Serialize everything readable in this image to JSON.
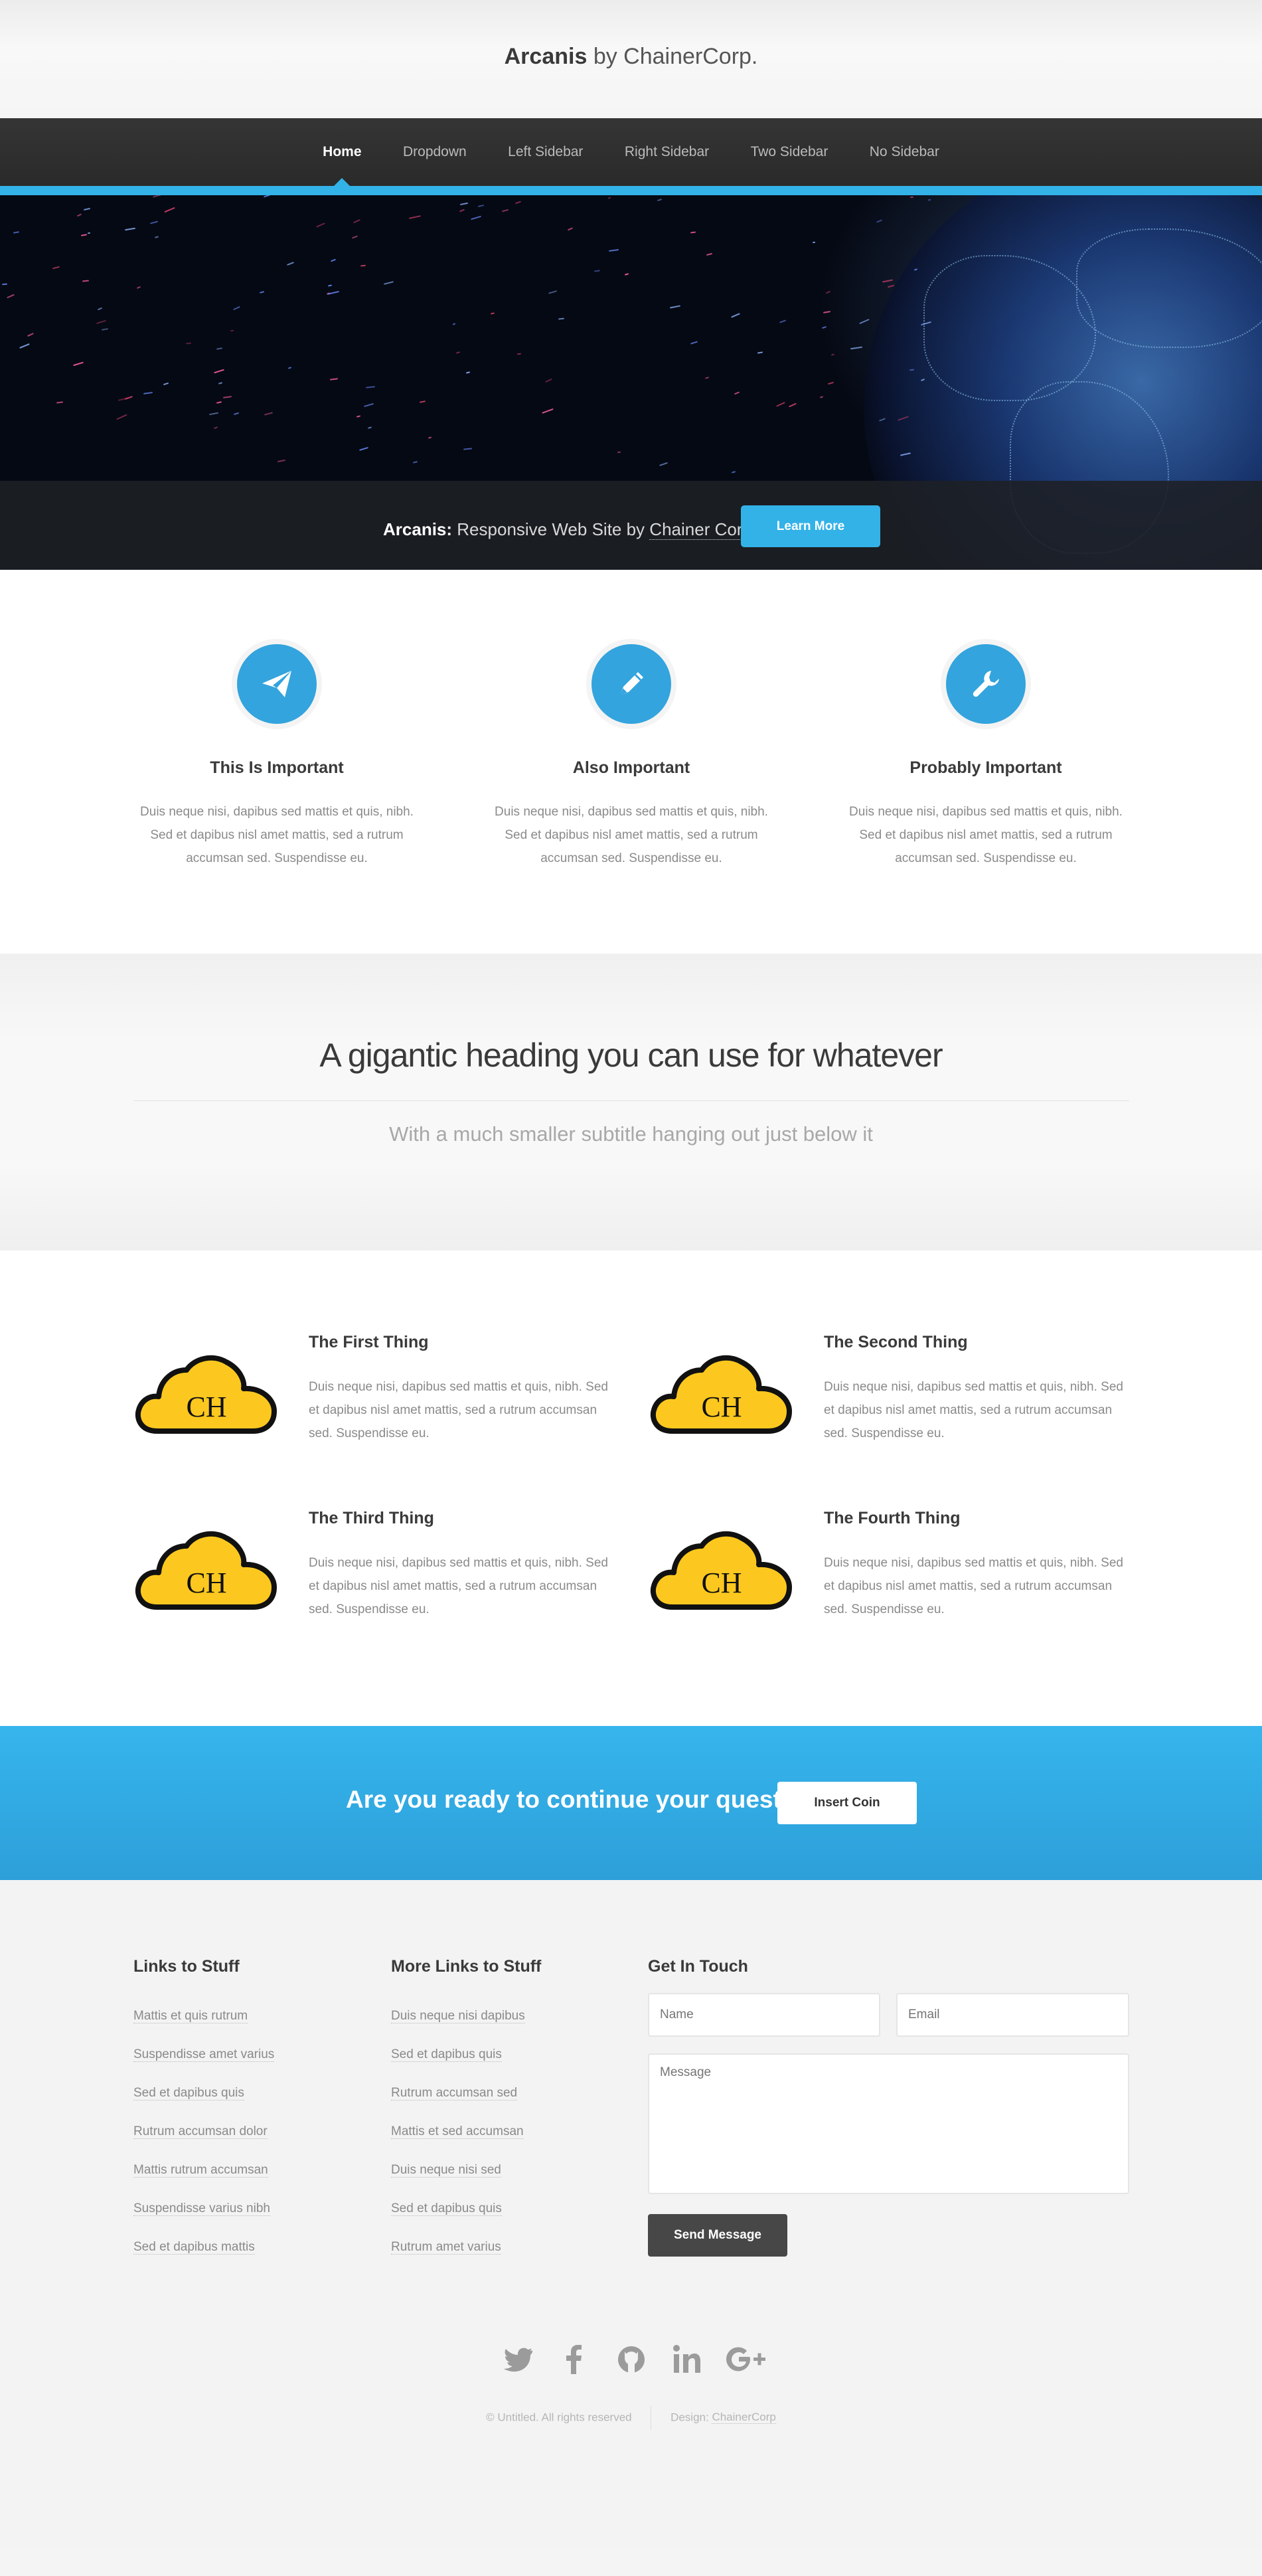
{
  "header": {
    "brand": "Arcanis",
    "brand_suffix": "by ChainerCorp."
  },
  "nav": {
    "items": [
      {
        "label": "Home"
      },
      {
        "label": "Dropdown"
      },
      {
        "label": "Left Sidebar"
      },
      {
        "label": "Right Sidebar"
      },
      {
        "label": "Two Sidebar"
      },
      {
        "label": "No Sidebar"
      }
    ]
  },
  "banner": {
    "tagline_bold": "Arcanis:",
    "tagline_text": "Responsive Web Site by",
    "tagline_link": "Chainer Corp",
    "button": "Learn More"
  },
  "features": [
    {
      "icon": "paper-plane-icon",
      "title": "This Is Important",
      "text": "Duis neque nisi, dapibus sed mattis et quis, nibh. Sed et dapibus nisl amet mattis, sed a rutrum accumsan sed. Suspendisse eu."
    },
    {
      "icon": "pencil-icon",
      "title": "Also Important",
      "text": "Duis neque nisi, dapibus sed mattis et quis, nibh. Sed et dapibus nisl amet mattis, sed a rutrum accumsan sed. Suspendisse eu."
    },
    {
      "icon": "wrench-icon",
      "title": "Probably Important",
      "text": "Duis neque nisi, dapibus sed mattis et quis, nibh. Sed et dapibus nisl amet mattis, sed a rutrum accumsan sed. Suspendisse eu."
    }
  ],
  "big": {
    "heading": "A gigantic heading you can use for whatever",
    "subtitle": "With a much smaller subtitle hanging out just below it"
  },
  "things": [
    {
      "title": "The First Thing",
      "text": "Duis neque nisi, dapibus sed mattis et quis, nibh. Sed et dapibus nisl amet mattis, sed a rutrum accumsan sed. Suspendisse eu."
    },
    {
      "title": "The Second Thing",
      "text": "Duis neque nisi, dapibus sed mattis et quis, nibh. Sed et dapibus nisl amet mattis, sed a rutrum accumsan sed. Suspendisse eu."
    },
    {
      "title": "The Third Thing",
      "text": "Duis neque nisi, dapibus sed mattis et quis, nibh. Sed et dapibus nisl amet mattis, sed a rutrum accumsan sed. Suspendisse eu."
    },
    {
      "title": "The Fourth Thing",
      "text": "Duis neque nisi, dapibus sed mattis et quis, nibh. Sed et dapibus nisl amet mattis, sed a rutrum accumsan sed. Suspendisse eu."
    }
  ],
  "logo_letters": "CH",
  "cta": {
    "question": "Are you ready to continue your quest?",
    "button": "Insert Coin"
  },
  "footer": {
    "col1": {
      "title": "Links to Stuff",
      "links": [
        "Mattis et quis rutrum",
        "Suspendisse amet varius",
        "Sed et dapibus quis",
        "Rutrum accumsan dolor",
        "Mattis rutrum accumsan",
        "Suspendisse varius nibh",
        "Sed et dapibus mattis"
      ]
    },
    "col2": {
      "title": "More Links to Stuff",
      "links": [
        "Duis neque nisi dapibus",
        "Sed et dapibus quis",
        "Rutrum accumsan sed",
        "Mattis et sed accumsan",
        "Duis neque nisi sed",
        "Sed et dapibus quis",
        "Rutrum amet varius"
      ]
    },
    "contact": {
      "title": "Get In Touch",
      "name_placeholder": "Name",
      "email_placeholder": "Email",
      "message_placeholder": "Message",
      "send": "Send Message"
    },
    "social": [
      "twitter-icon",
      "facebook-icon",
      "github-icon",
      "linkedin-icon",
      "google-plus-icon"
    ],
    "copyright": "© Untitled. All rights reserved",
    "design_label": "Design:",
    "design_link": "ChainerCorp"
  },
  "colors": {
    "accent": "#33b2e8",
    "dark": "#474747",
    "cloud_yellow": "#fcc81f"
  }
}
